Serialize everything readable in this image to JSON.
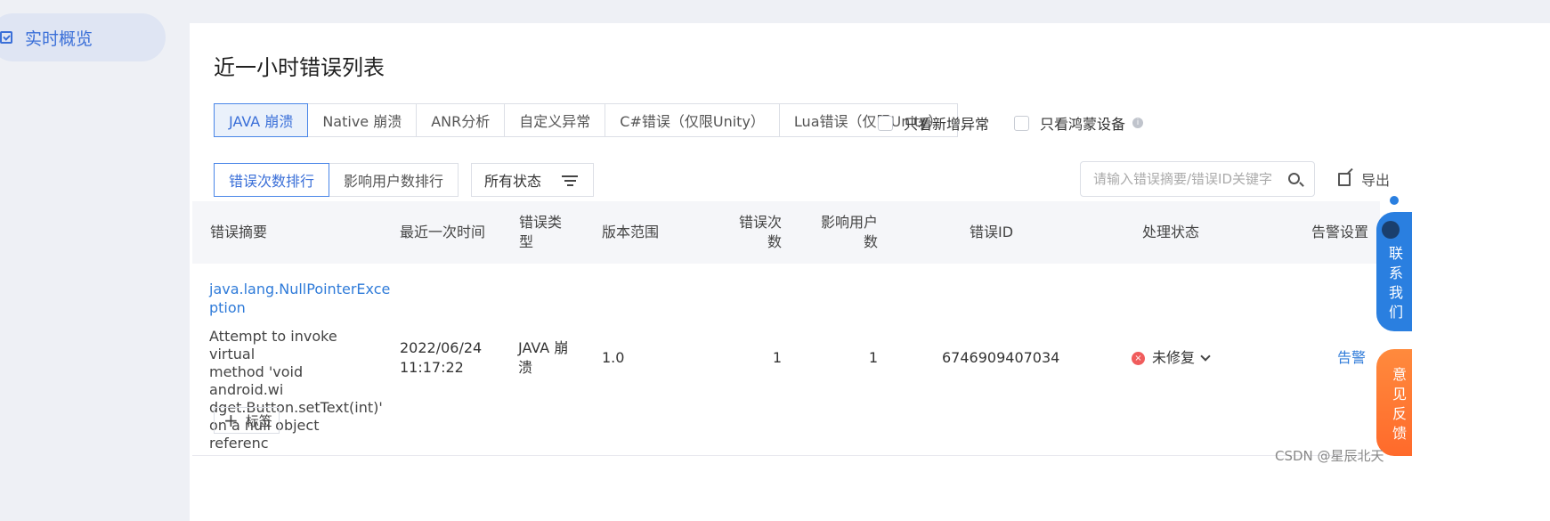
{
  "sidebar": {
    "item_label": "实时概览"
  },
  "page": {
    "title": "近一小时错误列表"
  },
  "tabs": [
    "JAVA 崩溃",
    "Native 崩溃",
    "ANR分析",
    "自定义异常",
    "C#错误（仅限Unity）",
    "Lua错误（仅限Unity）"
  ],
  "filters": {
    "only_new": "只看新增异常",
    "only_harmony": "只看鸿蒙设备"
  },
  "sort": {
    "by_count": "错误次数排行",
    "by_users": "影响用户数排行"
  },
  "status_filter": "所有状态",
  "search": {
    "placeholder": "请输入错误摘要/错误ID关键字"
  },
  "export_label": "导出",
  "table": {
    "headers": {
      "summary": "错误摘要",
      "last_time": "最近一次时间",
      "type_l1": "错误类",
      "type_l2": "型",
      "version": "版本范围",
      "count_l1": "错误次",
      "count_l2": "数",
      "users_l1": "影响用户",
      "users_l2": "数",
      "id": "错误ID",
      "status": "处理状态",
      "alarm": "告警设置"
    },
    "rows": [
      {
        "title_l1": "java.lang.NullPointerExce",
        "title_l2": "ption",
        "desc_l1": "Attempt to invoke virtual",
        "desc_l2": "method 'void android.wi",
        "desc_l3": "dget.Button.setText(int)'",
        "desc_l4": "on a null object referenc",
        "tag_label": "标签",
        "date": "2022/06/24",
        "time": "11:17:22",
        "type_l1": "JAVA 崩",
        "type_l2": "溃",
        "version": "1.0",
        "count": "1",
        "users": "1",
        "id": "6746909407034",
        "status": "未修复",
        "alarm": "告警"
      }
    ]
  },
  "floats": {
    "blue_text": "联系我们",
    "orange_text": "意见反馈"
  },
  "watermark": "CSDN @星辰北天",
  "colors": {
    "accent": "#3a6fd8",
    "link": "#2f7bd9",
    "error": "#f05c5c",
    "float_blue": "#2a7fe0",
    "float_orange": "#ff7a33"
  }
}
